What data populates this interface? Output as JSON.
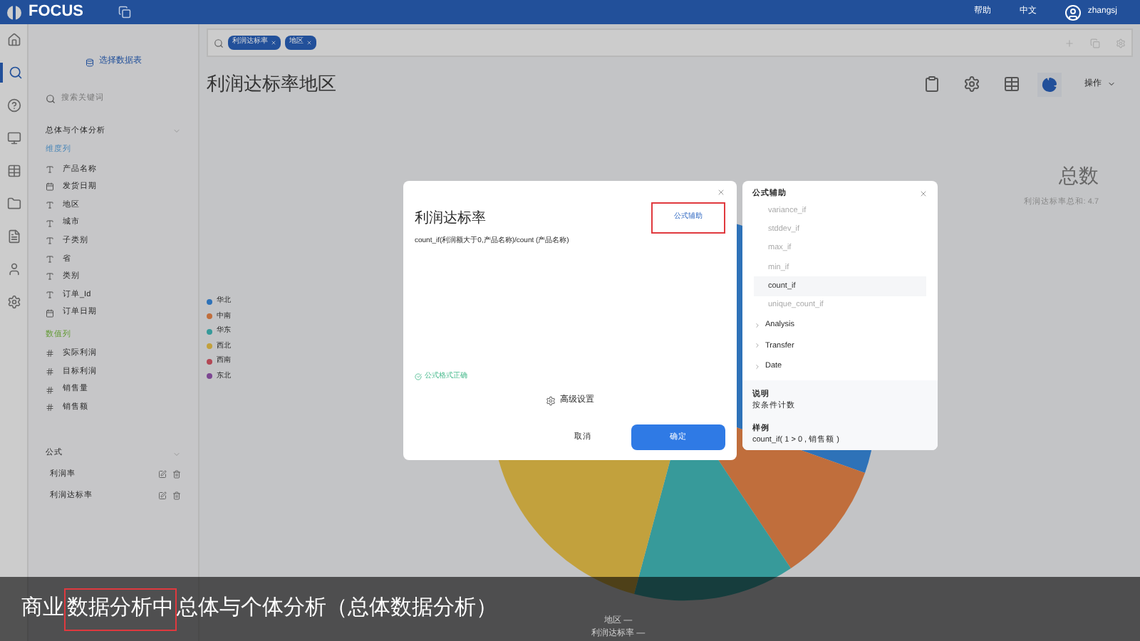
{
  "topbar": {
    "logo": "FOCUS",
    "links": [
      "帮助",
      "中文"
    ],
    "user": "zhangsj"
  },
  "rail": [
    {
      "selected": false
    },
    {
      "selected": true
    },
    {
      "selected": false
    },
    {
      "selected": false
    },
    {
      "selected": false
    },
    {
      "selected": false
    },
    {
      "selected": false
    },
    {
      "selected": false
    },
    {
      "selected": false
    }
  ],
  "sidebar": {
    "select_table": "选择数据表",
    "search": {
      "placeholder": "搜索关键词"
    },
    "table_name": "总体与个体分析",
    "groups": [
      {
        "title": "维度列",
        "fields": [
          {
            "kind": "text",
            "label": "产品名称"
          },
          {
            "kind": "date",
            "label": "发货日期"
          },
          {
            "kind": "text",
            "label": "地区"
          },
          {
            "kind": "text",
            "label": "城市"
          },
          {
            "kind": "text",
            "label": "子类别"
          },
          {
            "kind": "text",
            "label": "省"
          },
          {
            "kind": "text",
            "label": "类别"
          },
          {
            "kind": "text",
            "label": "订单_Id"
          },
          {
            "kind": "date",
            "label": "订单日期"
          }
        ]
      },
      {
        "title": "数值列",
        "fields": [
          {
            "kind": "number",
            "label": "实际利润"
          },
          {
            "kind": "number",
            "label": "目标利润"
          },
          {
            "kind": "number",
            "label": "销售量"
          },
          {
            "kind": "number",
            "label": "销售额"
          }
        ]
      }
    ],
    "formulas_title": "公式",
    "formulas": [
      "利润率",
      "利润达标率"
    ]
  },
  "search_tags": [
    "利润达标率",
    "地区"
  ],
  "page_title": "利润达标率地区",
  "actions": "操作",
  "legend": [
    {
      "label": "华北",
      "color": "#2e72b8"
    },
    {
      "label": "中南",
      "color": "#c06e3c"
    },
    {
      "label": "华东",
      "color": "#379a9a"
    },
    {
      "label": "西北",
      "color": "#c2a13d"
    },
    {
      "label": "西南",
      "color": "#b34855"
    },
    {
      "label": "东北",
      "color": "#7c4792"
    }
  ],
  "total": {
    "title": "总数",
    "value": "利润达标率总和: 4.7"
  },
  "axis_labels": [
    "地区 —",
    "利润达标率 —"
  ],
  "dialog": {
    "title": "利润达标率",
    "helper_link": "公式辅助",
    "formula": "count_if(利润额大于0,产品名称)/count (产品名称)",
    "status": "公式格式正确",
    "advanced": "高级设置",
    "cancel": "取消",
    "ok": "确定"
  },
  "helper": {
    "title": "公式辅助",
    "functions": [
      {
        "label": "variance_if",
        "selected": false
      },
      {
        "label": "stddev_if",
        "selected": false
      },
      {
        "label": "max_if",
        "selected": false
      },
      {
        "label": "min_if",
        "selected": false
      },
      {
        "label": "count_if",
        "selected": true
      },
      {
        "label": "unique_count_if",
        "selected": false
      }
    ],
    "groups": [
      "Analysis",
      "Transfer",
      "Date"
    ],
    "desc_title": "说明",
    "desc": "按条件计数",
    "example_title": "样例",
    "example": "count_if( 1 > 0 , 销售额 )"
  },
  "caption": {
    "before": "商业",
    "highlighted": "数据分析中",
    "after": "总体与个体分析（总体数据分析）"
  }
}
